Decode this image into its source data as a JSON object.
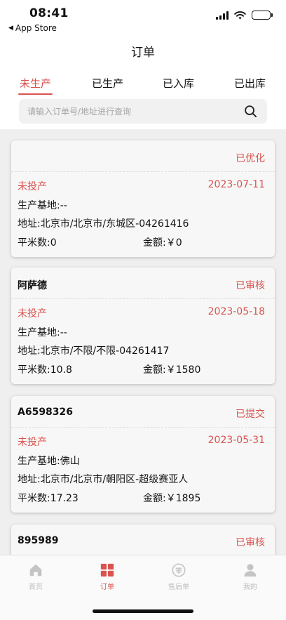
{
  "status_bar": {
    "time": "08:41",
    "back_app": "App Store"
  },
  "nav": {
    "title": "订单"
  },
  "tabs": [
    {
      "label": "未生产",
      "active": true
    },
    {
      "label": "已生产",
      "active": false
    },
    {
      "label": "已入库",
      "active": false
    },
    {
      "label": "已出库",
      "active": false
    }
  ],
  "search": {
    "placeholder": "请输入订单号/地址进行查询",
    "value": ""
  },
  "orders": [
    {
      "name": "",
      "state": "已优化",
      "production_status": "未投产",
      "date": "2023-07-11",
      "base": "生产基地:--",
      "address": "地址:北京市/北京市/东城区-04261416",
      "area": "平米数:0",
      "amount": "金额:￥0"
    },
    {
      "name": "阿萨德",
      "state": "已审核",
      "production_status": "未投产",
      "date": "2023-05-18",
      "base": "生产基地:--",
      "address": "地址:北京市/不限/不限-04261417",
      "area": "平米数:10.8",
      "amount": "金额:￥1580"
    },
    {
      "name": "A6598326",
      "state": "已提交",
      "production_status": "未投产",
      "date": "2023-05-31",
      "base": "生产基地:佛山",
      "address": "地址:北京市/北京市/朝阳区-超级赛亚人",
      "area": "平米数:17.23",
      "amount": "金额:￥1895"
    },
    {
      "name": "895989",
      "state": "已审核"
    }
  ],
  "tabbar": [
    {
      "label": "首页",
      "icon": "home-icon",
      "active": false
    },
    {
      "label": "订单",
      "icon": "orders-grid-icon",
      "active": true
    },
    {
      "label": "售后单",
      "icon": "after-sales-icon",
      "active": false
    },
    {
      "label": "我的",
      "icon": "profile-icon",
      "active": false
    }
  ],
  "colors": {
    "accent": "#d9534f",
    "inactive": "#bdbdbd"
  }
}
